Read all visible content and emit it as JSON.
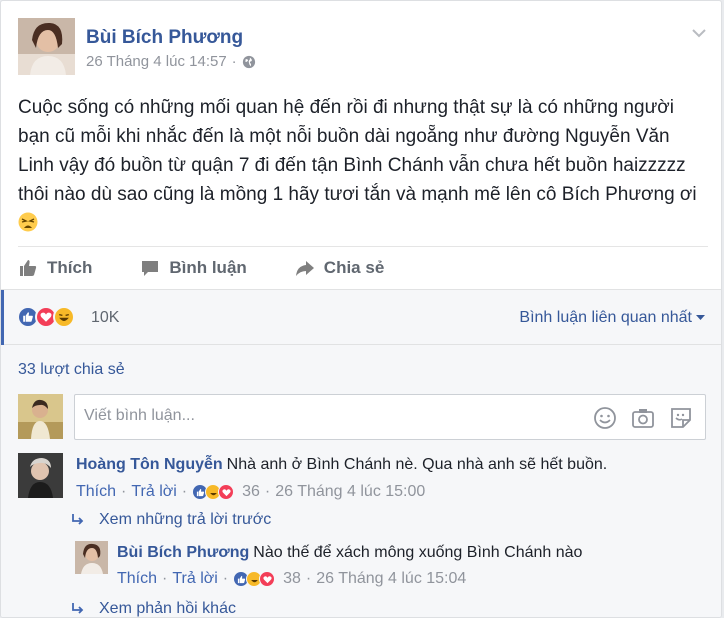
{
  "post": {
    "author": "Bùi Bích Phương",
    "timestamp": "26 Tháng 4 lúc 14:57",
    "separator": "·",
    "privacy_icon": "globe-icon",
    "text": "Cuộc sống có những mối quan hệ đến rồi đi nhưng thật sự là có những người bạn cũ mỗi khi nhắc đến là một nỗi buồn dài ngoẵng như đường Nguyễn Văn Linh vậy đó buồn từ quận 7 đi đến tận Bình Chánh vẫn chưa hết buồn haizzzzz thôi nào dù sao cũng là mồng 1 hãy tươi tắn và mạnh mẽ lên cô Bích Phương ơi"
  },
  "actions": {
    "like": "Thích",
    "comment": "Bình luận",
    "share": "Chia sẻ"
  },
  "reactions": {
    "count": "10K",
    "icons": [
      "like-icon",
      "love-icon",
      "haha-icon"
    ],
    "sort_label": "Bình luận liên quan nhất"
  },
  "shares_label": "33 lượt chia sẻ",
  "composer": {
    "placeholder": "Viết bình luận...",
    "tools": [
      "emoji-icon",
      "camera-icon",
      "sticker-icon"
    ]
  },
  "comments": [
    {
      "name": "Hoàng Tôn Nguyễn",
      "text": "Nhà anh ở Bình Chánh nè. Qua nhà anh sẽ hết buồn.",
      "like": "Thích",
      "reply": "Trả lời",
      "reaction_count": "36",
      "time": "26 Tháng 4 lúc 15:00"
    },
    {
      "name": "Bùi Bích Phương",
      "text": "Nào thế để xách mông xuống Bình Chánh nào",
      "like": "Thích",
      "reply": "Trả lời",
      "reaction_count": "38",
      "time": "26 Tháng 4 lúc 15:04"
    }
  ],
  "more_replies_1": "Xem những trả lời trước",
  "more_replies_2": "Xem phản hồi khác",
  "colors": {
    "link": "#365899",
    "like_blue": "#4267b2",
    "love_red": "#f33e58",
    "haha_yellow": "#f7b928"
  }
}
